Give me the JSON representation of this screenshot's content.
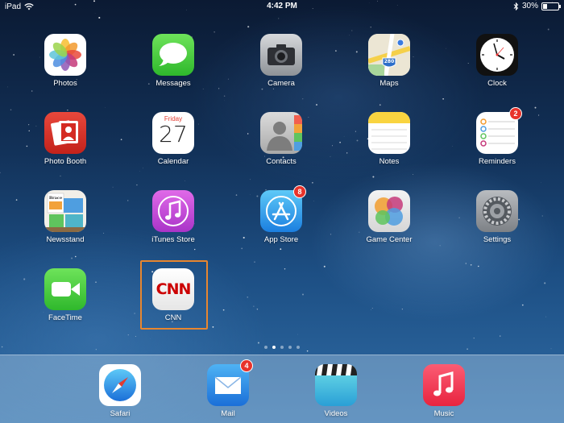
{
  "status_bar": {
    "device": "iPad",
    "time": "4:42 PM",
    "battery_percent": "30%",
    "battery_level": 0.3
  },
  "apps": [
    {
      "label": "Photos",
      "icon": "photos-icon"
    },
    {
      "label": "Messages",
      "icon": "messages-icon"
    },
    {
      "label": "Camera",
      "icon": "camera-icon"
    },
    {
      "label": "Maps",
      "icon": "maps-icon",
      "sign": "280"
    },
    {
      "label": "Clock",
      "icon": "clock-icon"
    },
    {
      "label": "Photo Booth",
      "icon": "photo-booth-icon"
    },
    {
      "label": "Calendar",
      "icon": "calendar-icon",
      "day_name": "Friday",
      "day_number": "27"
    },
    {
      "label": "Contacts",
      "icon": "contacts-icon"
    },
    {
      "label": "Notes",
      "icon": "notes-icon"
    },
    {
      "label": "Reminders",
      "icon": "reminders-icon",
      "badge": "2"
    },
    {
      "label": "Newsstand",
      "icon": "newsstand-icon",
      "magazine_title": "Brace"
    },
    {
      "label": "iTunes Store",
      "icon": "itunes-store-icon"
    },
    {
      "label": "App Store",
      "icon": "app-store-icon",
      "badge": "8"
    },
    {
      "label": "Game Center",
      "icon": "game-center-icon"
    },
    {
      "label": "Settings",
      "icon": "settings-icon"
    },
    {
      "label": "FaceTime",
      "icon": "facetime-icon"
    },
    {
      "label": "CNN",
      "icon": "cnn-icon",
      "logo_text": "CNN"
    }
  ],
  "dock": [
    {
      "label": "Safari",
      "icon": "safari-icon"
    },
    {
      "label": "Mail",
      "icon": "mail-icon",
      "badge": "4"
    },
    {
      "label": "Videos",
      "icon": "videos-icon"
    },
    {
      "label": "Music",
      "icon": "music-icon"
    }
  ],
  "page_dots": {
    "count": 5,
    "active": 1
  }
}
